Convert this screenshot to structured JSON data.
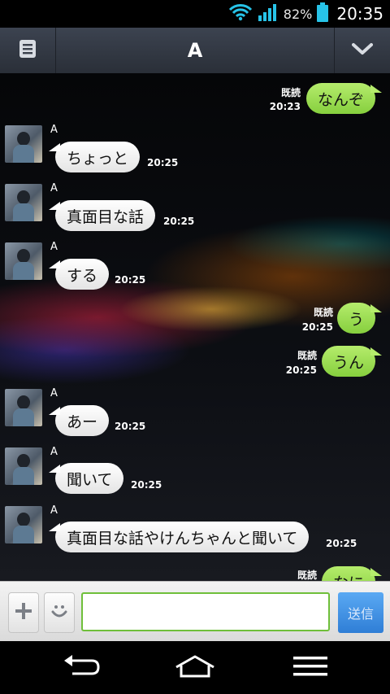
{
  "status_bar": {
    "battery": "82%",
    "time": "20:35"
  },
  "header": {
    "title": "A"
  },
  "contact_name": "A",
  "read_label": "既読",
  "messages": [
    {
      "side": "out",
      "text": "なんぞ",
      "time": "20:23",
      "read": true
    },
    {
      "side": "in",
      "text": "ちょっと",
      "time": "20:25"
    },
    {
      "side": "in",
      "text": "真面目な話",
      "time": "20:25"
    },
    {
      "side": "in",
      "text": "する",
      "time": "20:25"
    },
    {
      "side": "out",
      "text": "う",
      "time": "20:25",
      "read": true
    },
    {
      "side": "out",
      "text": "うん",
      "time": "20:25",
      "read": true
    },
    {
      "side": "in",
      "text": "あー",
      "time": "20:25"
    },
    {
      "side": "in",
      "text": "聞いて",
      "time": "20:25"
    },
    {
      "side": "in",
      "text": "真面目な話やけんちゃんと聞いて",
      "time": "20:25"
    },
    {
      "side": "out",
      "text": "なに",
      "time": "",
      "read": true
    }
  ],
  "input": {
    "send_label": "送信",
    "value": ""
  },
  "icons": {
    "menu": "menu-icon",
    "dropdown": "chevron-down-icon",
    "add": "plus-icon",
    "sticker": "smiley-icon",
    "back": "back-icon",
    "home": "home-icon",
    "recent": "menu-lines-icon"
  },
  "colors": {
    "accent_green": "#86cf3e",
    "send_blue": "#2f7ed6",
    "bubble_in": "#ffffff"
  }
}
